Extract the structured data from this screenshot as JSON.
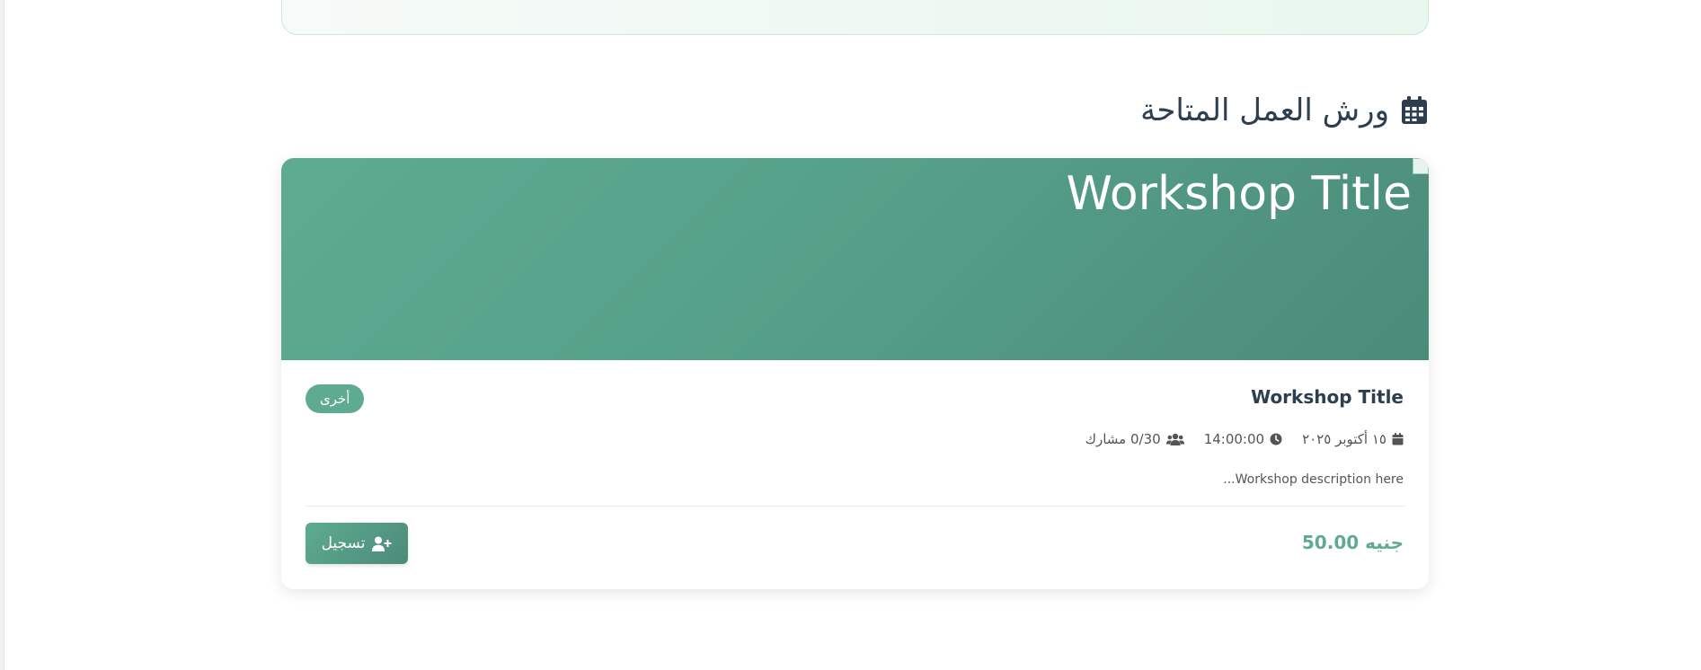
{
  "section": {
    "title": "ورش العمل المتاحة",
    "icon": "calendar-icon"
  },
  "workshop": {
    "image_alt": "Workshop Title",
    "title": "Workshop Title",
    "category": "أخرى",
    "date": "١٥ أكتوبر ٢٠٢٥",
    "time": "14:00:00",
    "participants": "0/30 مشارك",
    "description": "...Workshop description here",
    "price": "50.00 جنيه",
    "register_label": "تسجيل"
  },
  "colors": {
    "accent": "#5eab91",
    "accent_dark": "#4b8b79",
    "heading": "#2c3e50",
    "muted_text": "#555555"
  },
  "icons": {
    "date": "calendar-icon",
    "time": "clock-icon",
    "participants": "users-icon",
    "register": "user-plus-icon",
    "hero": "broken-image-icon"
  }
}
